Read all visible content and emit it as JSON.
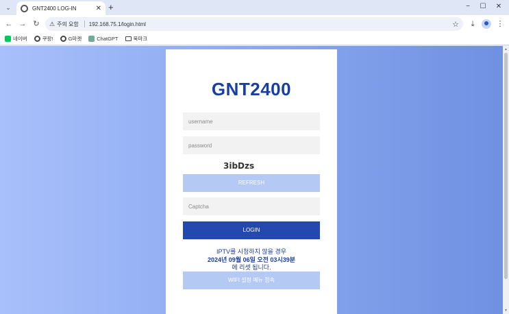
{
  "browser": {
    "tab": {
      "title": "GNT2400 LOG-IN",
      "favicon": "globe-icon",
      "close": "✕"
    },
    "new_tab": "+",
    "window": {
      "minimize": "−",
      "maximize": "☐",
      "close": "✕"
    },
    "nav": {
      "back": "←",
      "forward": "→",
      "reload": "↻"
    },
    "address": {
      "warning": "주의 요함",
      "url": "192.168.75.1/login.html"
    },
    "bookmarks": [
      {
        "label": "네이버",
        "icon": "naver-icon"
      },
      {
        "label": "쿠팡!",
        "icon": "globe-icon"
      },
      {
        "label": "G마켓",
        "icon": "globe-icon"
      },
      {
        "label": "ChatGPT",
        "icon": "chatgpt-icon"
      },
      {
        "label": "북마크",
        "icon": "folder-icon"
      }
    ]
  },
  "login": {
    "brand": "GNT2400",
    "username_placeholder": "username",
    "password_placeholder": "password",
    "captcha_code": "3ibDzs",
    "refresh_label": "REFRESH",
    "captcha_placeholder": "Captcha",
    "login_label": "LOGIN",
    "notice_line1": "IPTV를 시청하지 않을 경우",
    "notice_line2": "2024년 09월 06일 오전 03시39분",
    "notice_line3": "에 리셋 됩니다.",
    "wifi_label": "WIFI 설정 메뉴 접속"
  },
  "colors": {
    "brand": "#1a3ea8",
    "login_button": "#2349b0",
    "light_button": "#b4c9f3",
    "background_left": "#a8c0fb",
    "background_right": "#6f8fe1"
  }
}
